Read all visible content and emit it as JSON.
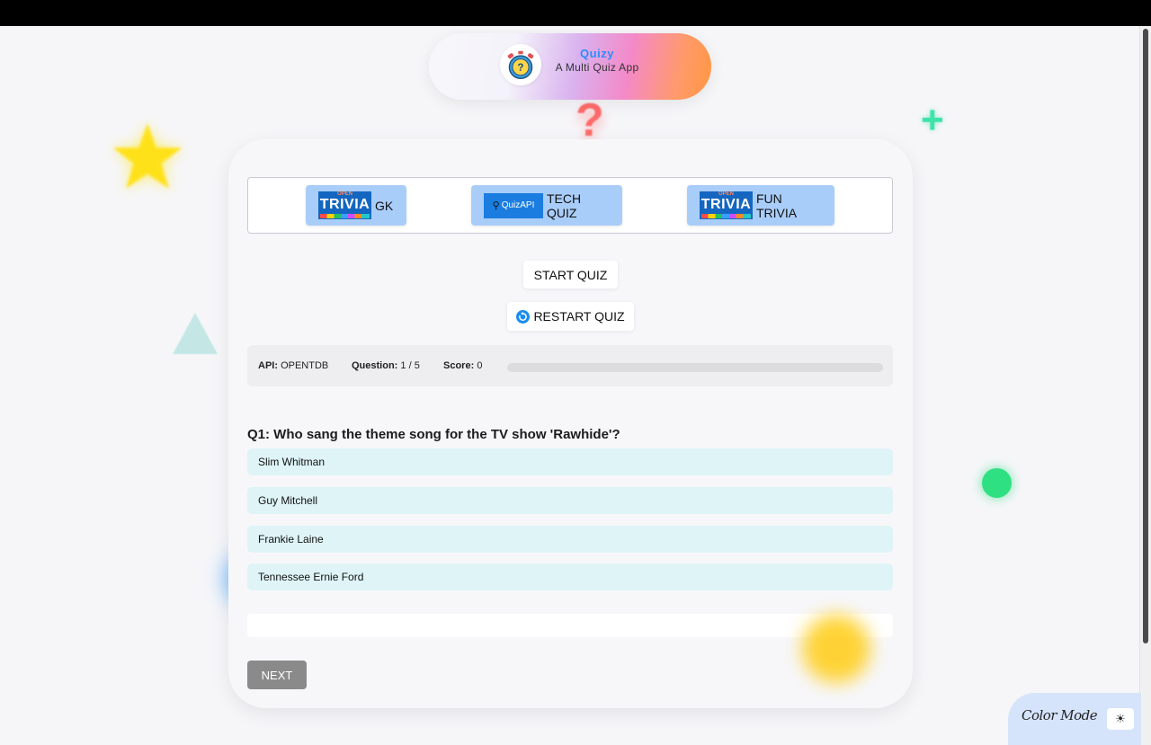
{
  "app": {
    "title": "Quizy",
    "subtitle": "A Multi Quiz App",
    "logo_icon": "stopwatch-question-icon"
  },
  "api_buttons": [
    {
      "label": "GK",
      "logo": "OPEN TRIVIA DATABASE",
      "logo_word": "TRIVIA",
      "logo_top": "OPEN"
    },
    {
      "label": "TECH QUIZ",
      "logo": "QuizAPI"
    },
    {
      "label": "FUN TRIVIA",
      "logo": "OPEN TRIVIA DATABASE",
      "logo_word": "TRIVIA",
      "logo_top": "OPEN"
    }
  ],
  "controls": {
    "start_label": "START QUIZ",
    "restart_label": "RESTART QUIZ",
    "next_label": "NEXT"
  },
  "status": {
    "api_label": "API:",
    "api_value": "OPENTDB",
    "question_label": "Question:",
    "question_value": "1 / 5",
    "score_label": "Score:",
    "score_value": "0",
    "progress_fraction": 0
  },
  "question": {
    "text": "Q1: Who sang the theme song for the TV show 'Rawhide'?",
    "options": [
      "Slim Whitman",
      "Guy Mitchell",
      "Frankie Laine",
      "Tennessee Ernie Ford"
    ]
  },
  "color_mode": {
    "label": "Color Mode",
    "toggle_icon": "sun-icon"
  },
  "colors": {
    "accent": "#2b8cff",
    "api_button_bg": "#a9cdf9",
    "option_bg": "#dff4f7",
    "next_button_bg": "#8a8a8a"
  }
}
